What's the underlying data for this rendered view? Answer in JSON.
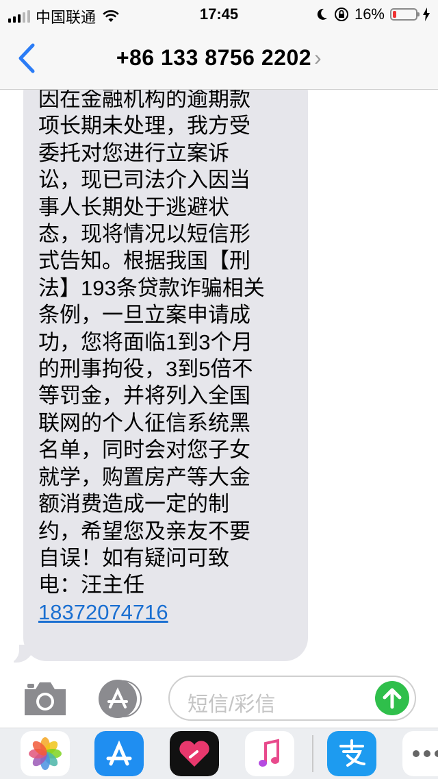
{
  "status_bar": {
    "carrier": "中国联通",
    "time": "17:45",
    "battery_percent": "16%",
    "battery_level": 0.16,
    "icons": [
      "signal-icon",
      "wifi-icon",
      "moon-icon",
      "orientation-lock-icon",
      "battery-icon",
      "charging-icon"
    ]
  },
  "nav": {
    "title": "+86 133 8756 2202",
    "chevron": "›",
    "back_icon": "chevron-left-icon"
  },
  "message": {
    "body": "因在金融机构的逾期款\n项长期未处理，我方受\n委托对您进行立案诉\n讼，现已司法介入因当\n事人长期处于逃避状\n态，现将情况以短信形\n式告知。根据我国【刑\n法】193条贷款诈骗相关\n条例，一旦立案申请成\n功，您将面临1到3个月\n的刑事拘役，3到5倍不\n等罚金，并将列入全国\n联网的个人征信系统黑\n名单，同时会对您子女\n就学，购置房产等大金\n额消费造成一定的制\n约，希望您及亲友不要\n自误！如有疑问可致\n电：汪主任",
    "phone_link": "18372074716"
  },
  "input_bar": {
    "placeholder": "短信/彩信",
    "camera_icon": "camera-icon",
    "appstore_icon": "app-store-icon",
    "send_icon": "send-arrow-icon"
  },
  "app_drawer": {
    "apps": [
      "photos-icon",
      "app-store-icon",
      "heart-app-icon",
      "music-icon",
      "alipay-icon",
      "more-icon"
    ]
  },
  "colors": {
    "bubble": "#e6e6eb",
    "link": "#1a6fd1",
    "back_accent": "#2b7cf6",
    "send": "#2fbf4b",
    "battery_low": "#e33333"
  }
}
